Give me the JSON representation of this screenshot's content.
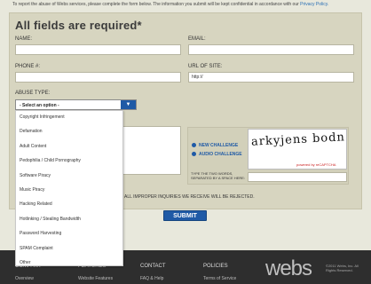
{
  "intro": {
    "text": "To report the abuse of Webs services, please complete the form below. The information you submit will be kept confidential in accordance with our",
    "link": "Privacy Policy."
  },
  "form": {
    "heading": "All fields are required*",
    "name_label": "NAME:",
    "email_label": "EMAIL:",
    "phone_label": "PHONE #:",
    "url_label": "URL OF SITE:",
    "url_value": "http://",
    "abuse_label": "ABUSE TYPE:",
    "abuse_selected": "- Select an option -",
    "abuse_options": [
      "Copyright Infringement",
      "Defamation",
      "Adult Content",
      "Pedophilia / Child Pornography",
      "Software Piracy",
      "Music Piracy",
      "Hacking Related",
      "Hotlinking / Stealing Bandwidth",
      "Password Harvesting",
      "SPAM Complaint",
      "Other"
    ],
    "notice": "ALL IMPROPER INQUIRIES WE RECEIVE WILL BE REJECTED.",
    "submit": "SUBMIT"
  },
  "captcha": {
    "word": "arkyjens bodn",
    "new_challenge": "NEW CHALLENGE",
    "audio_challenge": "AUDIO CHALLENGE",
    "instruction": "TYPE THE TWO WORDS, SEPARATED BY A SPACE HERE:",
    "credit": "powered by reCAPTCHA"
  },
  "footer": {
    "sections": [
      {
        "title": "COMPANY",
        "link": "Overview"
      },
      {
        "title": "FEATURES",
        "link": "Website Features"
      },
      {
        "title": "CONTACT",
        "link": "FAQ & Help"
      },
      {
        "title": "POLICIES",
        "link": "Terms of Service"
      }
    ],
    "logo": "webs",
    "copyright": "©2011 Webs, Inc. All Rights Reserved."
  },
  "colors": {
    "accent": "#1f5aa6",
    "panel": "#d7d5c0",
    "footer": "#2e2e2e"
  }
}
